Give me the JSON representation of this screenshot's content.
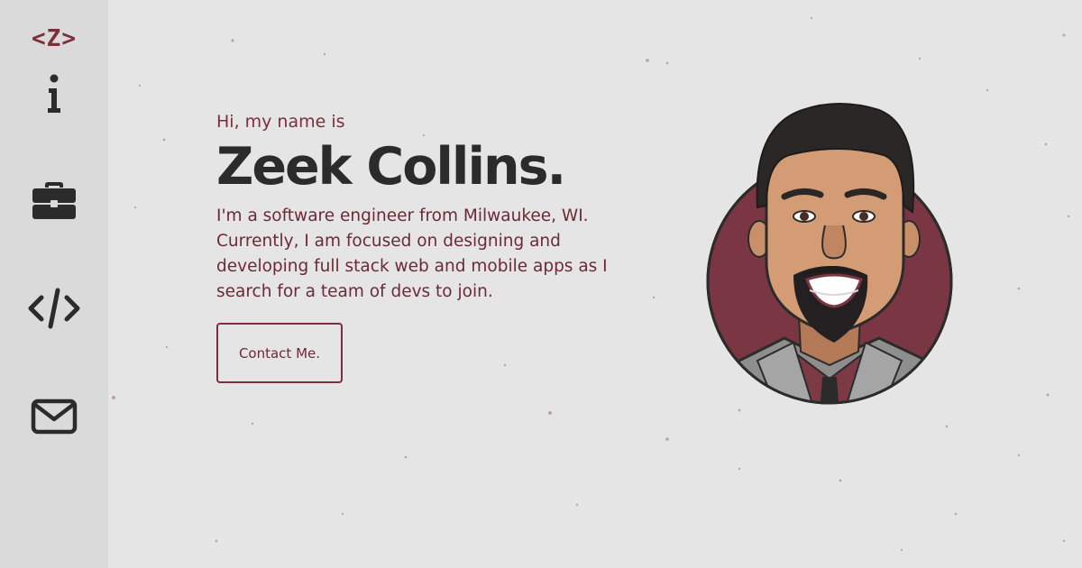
{
  "brand": {
    "logo_text": "<Z>"
  },
  "sidebar": {
    "items": [
      {
        "name": "about",
        "icon": "info-icon"
      },
      {
        "name": "experience",
        "icon": "briefcase-icon"
      },
      {
        "name": "projects",
        "icon": "code-icon"
      },
      {
        "name": "contact",
        "icon": "envelope-icon"
      }
    ]
  },
  "hero": {
    "greeting": "Hi, my name is",
    "name": "Zeek Collins.",
    "bio": "I'm a software engineer from Milwaukee, WI. Currently, I am focused on designing and developing full stack web and mobile apps as I search for a team of devs to join.",
    "cta_label": "Contact Me."
  },
  "colors": {
    "accent": "#7a2f3a",
    "text_dark": "#2b2b2b",
    "background": "#e6e5e5",
    "sidebar": "#dadada"
  }
}
